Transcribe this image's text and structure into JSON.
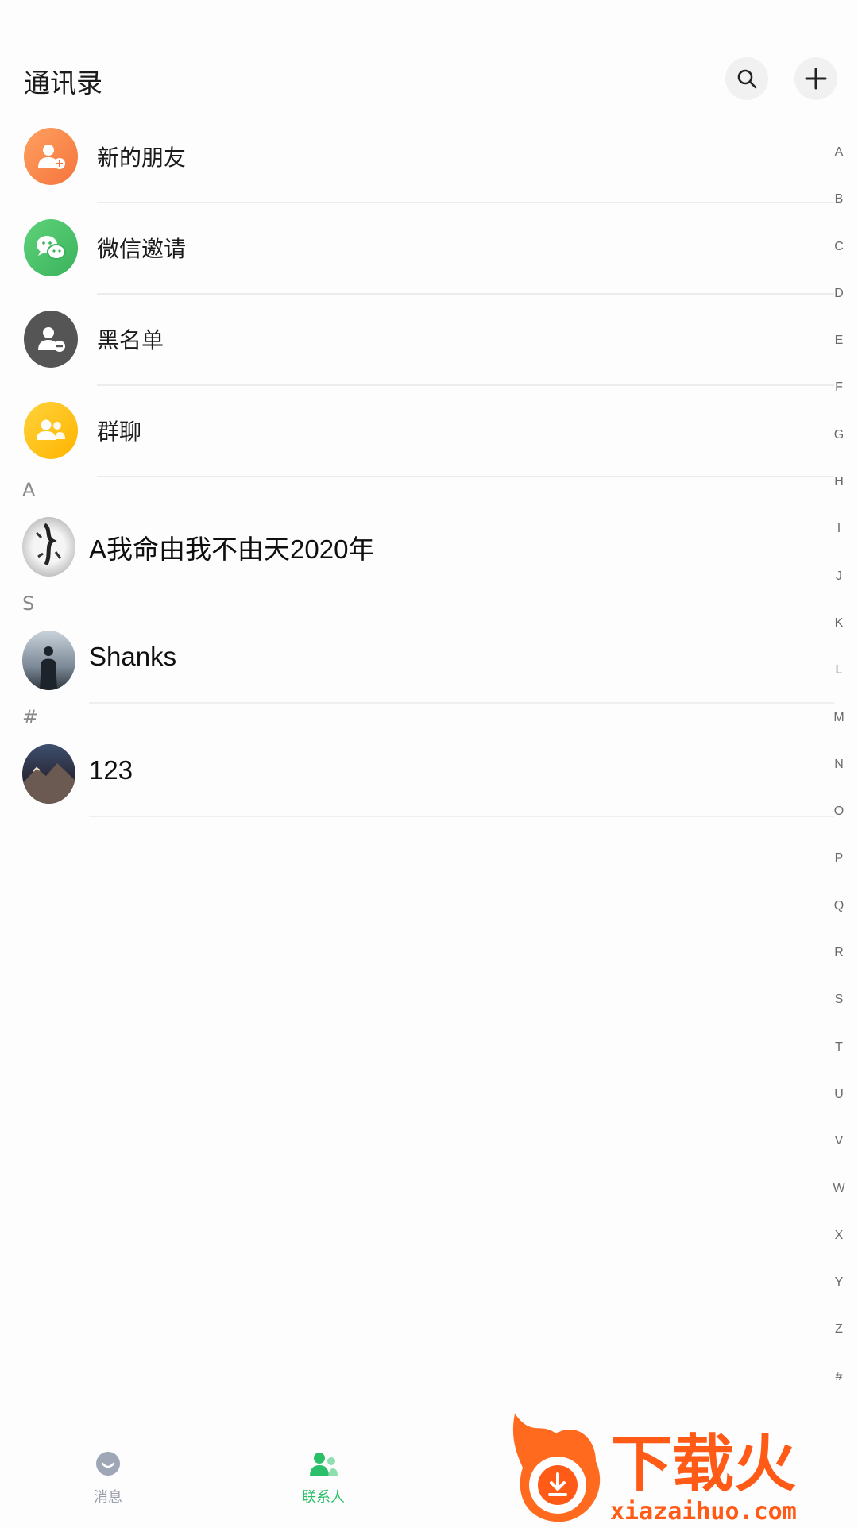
{
  "header": {
    "title": "通讯录",
    "search_icon": "search-icon",
    "add_icon": "plus-icon"
  },
  "entries": [
    {
      "label": "新的朋友",
      "icon": "add-user-icon",
      "color": "#f88a4a"
    },
    {
      "label": "微信邀请",
      "icon": "wechat-icon",
      "color": "#4fc46a"
    },
    {
      "label": "黑名单",
      "icon": "block-user-icon",
      "color": "#5a5a5a"
    },
    {
      "label": "群聊",
      "icon": "group-icon",
      "color": "#ffc21a"
    }
  ],
  "sections": [
    {
      "letter": "A",
      "contacts": [
        {
          "name": "A我命由我不由天2020年"
        }
      ]
    },
    {
      "letter": "S",
      "contacts": [
        {
          "name": "Shanks"
        }
      ]
    },
    {
      "letter": "#",
      "contacts": [
        {
          "name": "123"
        }
      ]
    }
  ],
  "alphabet": [
    "A",
    "B",
    "C",
    "D",
    "E",
    "F",
    "G",
    "H",
    "I",
    "J",
    "K",
    "L",
    "M",
    "N",
    "O",
    "P",
    "Q",
    "R",
    "S",
    "T",
    "U",
    "V",
    "W",
    "X",
    "Y",
    "Z",
    "#"
  ],
  "tabs": [
    {
      "label": "消息",
      "active": false,
      "color": "#9a9fab"
    },
    {
      "label": "联系人",
      "active": true,
      "color": "#2bbf6a"
    }
  ],
  "watermark": {
    "brand": "下载火",
    "url": "xiazaihuo.com"
  }
}
